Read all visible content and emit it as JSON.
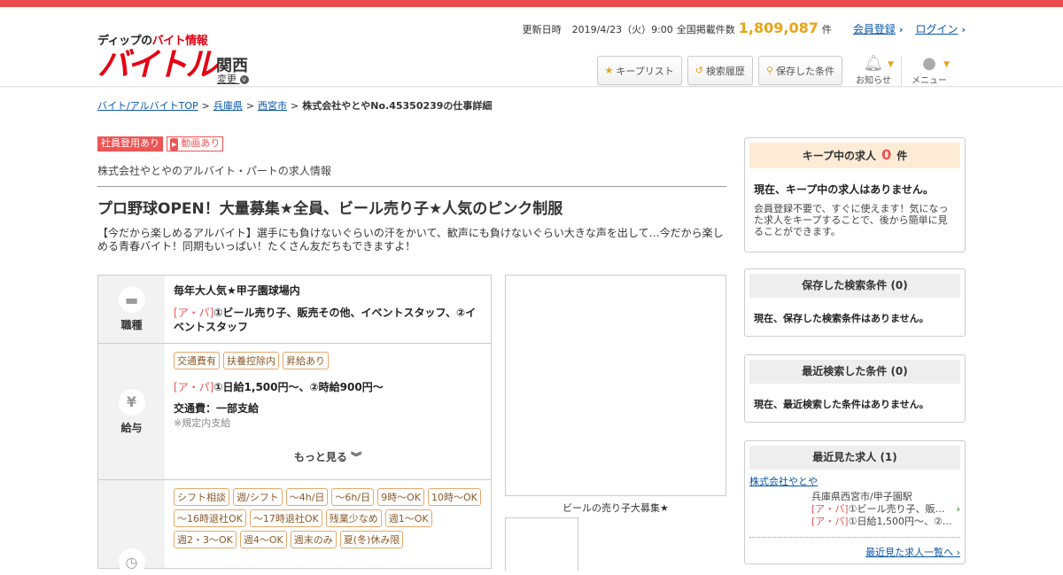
{
  "header": {
    "logo_sub_prefix": "ディップの",
    "logo_sub_highlight": "バイト情報",
    "logo_main": "バイトル",
    "region": "関西",
    "region_change": "変更",
    "update_label": "更新日時",
    "update_date": "2019/4/23（火）9:00",
    "listings_label": "全国掲載件数",
    "listings_count": "1,809,087",
    "listings_unit": "件",
    "register_link": "会員登録",
    "login_link": "ログイン",
    "keep_list_btn": "キープリスト",
    "search_history_btn": "検索履歴",
    "saved_conditions_btn": "保存した条件",
    "notification_label": "お知らせ",
    "menu_label": "メニュー"
  },
  "breadcrumb": {
    "items": [
      "バイト/アルバイトTOP",
      "兵庫県",
      "西宮市"
    ],
    "current": "株式会社やとやNo.45350239の仕事詳細"
  },
  "job": {
    "badge_employee": "社員登用あり",
    "badge_video": "動画あり",
    "company_line": "株式会社やとやのアルバイト・パートの求人情報",
    "title": "プロ野球OPEN！大量募集★全員、ビール売り子★人気のピンク制服",
    "lead": "【今だから楽しめるアルバイト】選手にも負けないぐらいの汗をかいて、歓声にも負けないぐらい大きな声を出して…今だから楽しめる青春バイト！同期もいっぱい！たくさん友だちもできますよ！",
    "job_type_label": "職種",
    "job_location_title": "毎年大人気★甲子園球場内",
    "job_tag": "[ア・パ]",
    "job_type_text": "①ビール売り子、販売その他、イベントスタッフ、②イベントスタッフ",
    "salary_label": "給与",
    "salary_chips": [
      "交通費有",
      "扶養控除内",
      "昇給あり"
    ],
    "salary_tag": "[ア・パ]",
    "salary_text": "①日給1,500円～、②時給900円～",
    "transport": "交通費：一部支給",
    "transport_note": "※規定内支給",
    "more": "もっと見る",
    "time_chips": [
      "シフト相談",
      "週/シフト",
      "～4h/日",
      "～6h/日",
      "9時～OK",
      "10時～OK",
      "～16時退社OK",
      "～17時退社OK",
      "残業少なめ",
      "週1〜OK",
      "週2・3〜OK",
      "週4〜OK",
      "週末のみ",
      "夏(冬)休み限"
    ],
    "photo_caption": "ビールの売り子大募集★"
  },
  "sidebar": {
    "keep_title": "キープ中の求人",
    "keep_count": "0",
    "keep_unit": "件",
    "keep_empty": "現在、キープ中の求人はありません。",
    "keep_desc": "会員登録不要で、すぐに使えます！気になった求人をキープすることで、後から簡単に見ることができます。",
    "saved_title": "保存した検索条件",
    "saved_count": "(0)",
    "saved_empty": "現在、保存した検索条件はありません。",
    "recent_search_title": "最近検索した条件",
    "recent_search_count": "(0)",
    "recent_search_empty": "現在、最近検索した条件はありません。",
    "recent_view_title": "最近見た求人",
    "recent_view_count": "(1)",
    "recent_company": "株式会社やとや",
    "recent_location": "兵庫県西宮市/甲子園駅",
    "recent_tag": "[ア・パ]",
    "recent_job": "①ビール売り子、販…",
    "recent_salary": "①日給1,500円～、②…",
    "recent_list_link": "最近見た求人一覧へ"
  },
  "colors": {
    "brand_red": "#e60012",
    "accent_orange": "#e8a317",
    "topbar": "#ea4d4d"
  }
}
